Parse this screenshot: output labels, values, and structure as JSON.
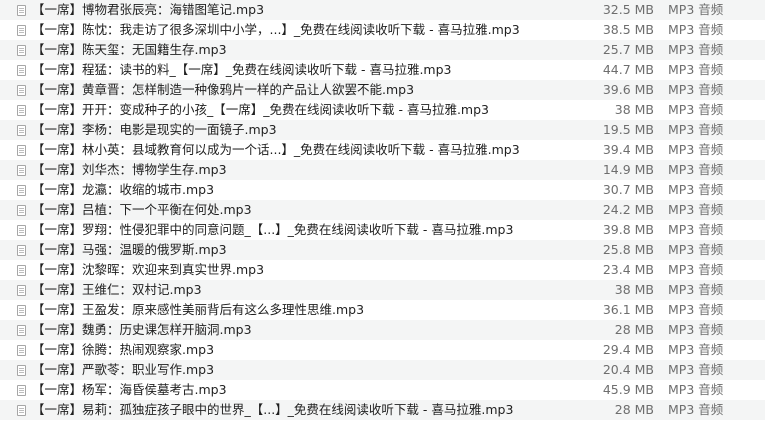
{
  "files": [
    {
      "name": "【一席】博物君张辰亮：海错图笔记.mp3",
      "size": "32.5 MB",
      "kind": "MP3 音频"
    },
    {
      "name": "【一席】陈忱：我走访了很多深圳中小学，...】_免费在线阅读收听下载 - 喜马拉雅.mp3",
      "size": "38.5 MB",
      "kind": "MP3 音频"
    },
    {
      "name": "【一席】陈天玺：无国籍生存.mp3",
      "size": "25.7 MB",
      "kind": "MP3 音频"
    },
    {
      "name": "【一席】程猛：读书的料_【一席】_免费在线阅读收听下载 - 喜马拉雅.mp3",
      "size": "44.7 MB",
      "kind": "MP3 音频"
    },
    {
      "name": "【一席】黄章晋：怎样制造一种像鸦片一样的产品让人欲罢不能.mp3",
      "size": "39.6 MB",
      "kind": "MP3 音频"
    },
    {
      "name": "【一席】开开：变成种子的小孩_【一席】_免费在线阅读收听下载 - 喜马拉雅.mp3",
      "size": "38 MB",
      "kind": "MP3 音频"
    },
    {
      "name": "【一席】李杨：电影是现实的一面镜子.mp3",
      "size": "19.5 MB",
      "kind": "MP3 音频"
    },
    {
      "name": "【一席】林小英：县域教育何以成为一个话...】_免费在线阅读收听下载 - 喜马拉雅.mp3",
      "size": "39.4 MB",
      "kind": "MP3 音频"
    },
    {
      "name": "【一席】刘华杰：博物学生存.mp3",
      "size": "14.9 MB",
      "kind": "MP3 音频"
    },
    {
      "name": "【一席】龙瀛：收缩的城市.mp3",
      "size": "30.7 MB",
      "kind": "MP3 音频"
    },
    {
      "name": "【一席】吕植：下一个平衡在何处.mp3",
      "size": "24.2 MB",
      "kind": "MP3 音频"
    },
    {
      "name": "【一席】罗翔：性侵犯罪中的同意问题_【...】_免费在线阅读收听下载 - 喜马拉雅.mp3",
      "size": "39.8 MB",
      "kind": "MP3 音频"
    },
    {
      "name": "【一席】马强：温暖的俄罗斯.mp3",
      "size": "25.8 MB",
      "kind": "MP3 音频"
    },
    {
      "name": "【一席】沈黎晖：欢迎来到真实世界.mp3",
      "size": "23.4 MB",
      "kind": "MP3 音频"
    },
    {
      "name": "【一席】王维仁：双村记.mp3",
      "size": "38 MB",
      "kind": "MP3 音频"
    },
    {
      "name": "【一席】王盈发：原来感性美丽背后有这么多理性思维.mp3",
      "size": "36.1 MB",
      "kind": "MP3 音频"
    },
    {
      "name": "【一席】魏勇：历史课怎样开脑洞.mp3",
      "size": "28 MB",
      "kind": "MP3 音频"
    },
    {
      "name": "【一席】徐腾：热闹观察家.mp3",
      "size": "29.4 MB",
      "kind": "MP3 音频"
    },
    {
      "name": "【一席】严歌苓：职业写作.mp3",
      "size": "20.4 MB",
      "kind": "MP3 音频"
    },
    {
      "name": "【一席】杨军：海昏侯墓考古.mp3",
      "size": "45.9 MB",
      "kind": "MP3 音频"
    },
    {
      "name": "【一席】易莉：孤独症孩子眼中的世界_【...】_免费在线阅读收听下载 - 喜马拉雅.mp3",
      "size": "28 MB",
      "kind": "MP3 音频"
    }
  ]
}
